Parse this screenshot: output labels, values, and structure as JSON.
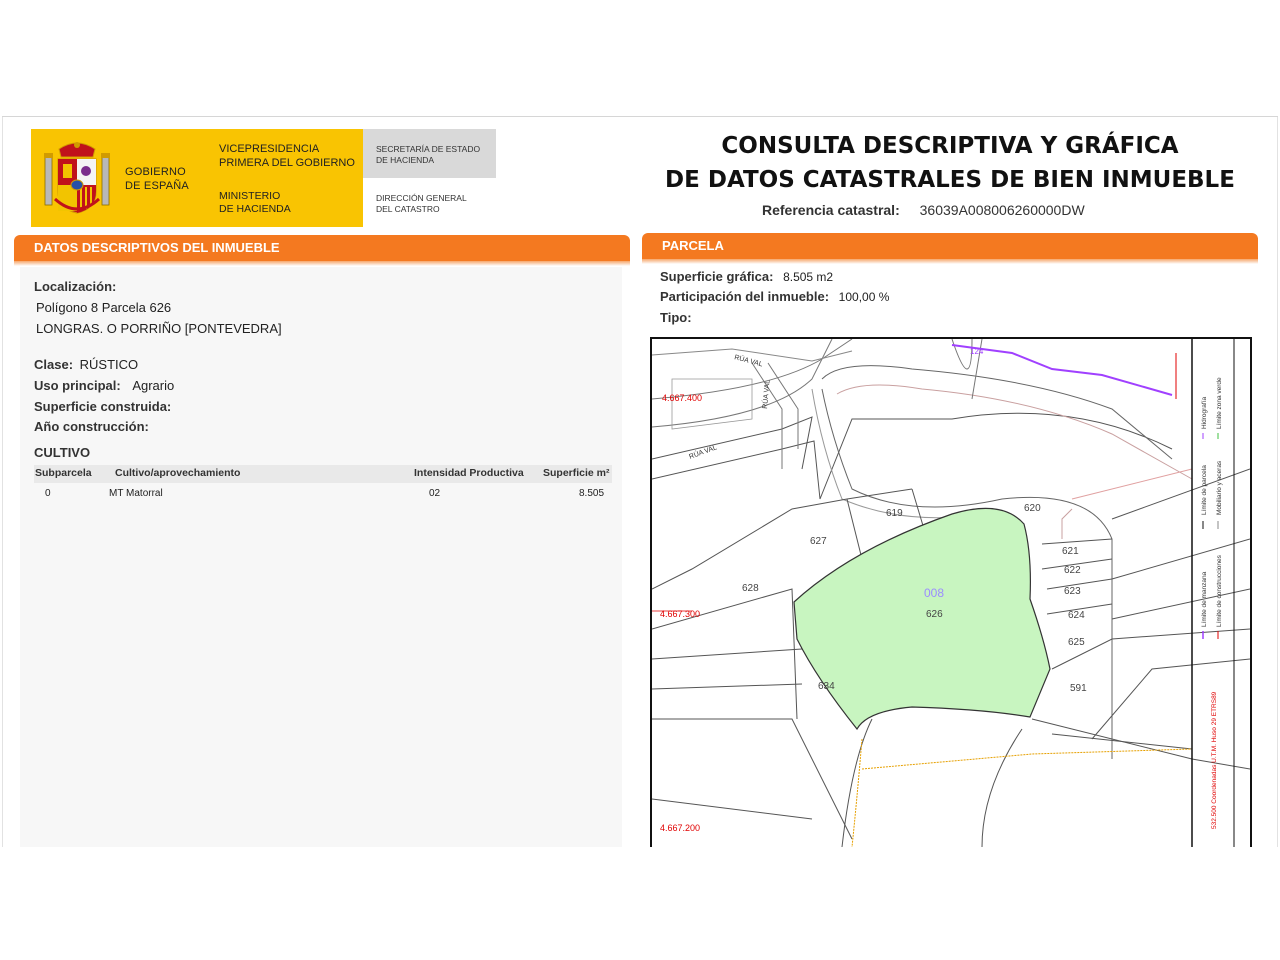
{
  "logo": {
    "gobierno": [
      "GOBIERNO",
      "DE ESPAÑA"
    ],
    "vicepresidencia": [
      "VICEPRESIDENCIA",
      "PRIMERA DEL GOBIERNO"
    ],
    "ministerio": [
      "MINISTERIO",
      "DE HACIENDA"
    ],
    "secretaria": [
      "SECRETARÍA DE ESTADO",
      "DE HACIENDA"
    ],
    "direccion": [
      "DIRECCIÓN GENERAL",
      "DEL CATASTRO"
    ],
    "colors": {
      "yellow": "#f9c402",
      "grey": "#d9d9d9"
    }
  },
  "header": {
    "title_line1": "CONSULTA DESCRIPTIVA Y GRÁFICA",
    "title_line2": "DE DATOS CATASTRALES DE BIEN INMUEBLE",
    "ref_label": "Referencia catastral:",
    "ref_value": "36039A008006260000DW"
  },
  "accent_color": "#f47920",
  "descriptivos": {
    "heading": "DATOS DESCRIPTIVOS DEL INMUEBLE",
    "localizacion_label": "Localización:",
    "localizacion_line1": "Polígono 8 Parcela 626",
    "localizacion_line2": "LONGRAS. O PORRIÑO [PONTEVEDRA]",
    "clase_label": "Clase:",
    "clase_value": "RÚSTICO",
    "uso_label": "Uso principal:",
    "uso_value": "Agrario",
    "superficie_label": "Superficie construida:",
    "anio_label": "Año construcción:",
    "cultivo": {
      "heading": "CULTIVO",
      "columns": [
        "Subparcela",
        "Cultivo/aprovechamiento",
        "Intensidad Productiva",
        "Superficie m²"
      ],
      "rows": [
        {
          "subparcela": "0",
          "cultivo": "MT Matorral",
          "intensidad": "02",
          "superficie": "8.505"
        }
      ]
    }
  },
  "parcela": {
    "heading": "PARCELA",
    "superficie_label": "Superficie gráfica:",
    "superficie_value": "8.505 m2",
    "participacion_label": "Participación del inmueble:",
    "participacion_value": "100,00 %",
    "tipo_label": "Tipo:"
  },
  "map": {
    "street_top": "RÚA VAL",
    "street_vertical": "RÚA VAL",
    "street_left": "RÚA VAL",
    "stream_label": "124",
    "coord_top": "4.667.400",
    "coord_mid": "4.667.300",
    "coord_bottom": "4.667.200",
    "polygon_label": "008",
    "parcel_labels": [
      "619",
      "620",
      "621",
      "622",
      "623",
      "624",
      "625",
      "626",
      "627",
      "628",
      "634",
      "591"
    ],
    "legend": {
      "hidrografia": "Hidrografía",
      "limite_zona_verde": "Límite zona verde",
      "limite_parcela": "Límite de parcela",
      "mobiliario": "Mobiliario y aceras",
      "limite_manzana": "Límite de manzana",
      "limite_construcciones": "Límite de construcciones",
      "coordenadas": "532.500 Coordenadas U.T.M. Huso 29 ETRS89"
    },
    "colors": {
      "parcel_fill": "#c8f5c0",
      "hydro": "#a040ff",
      "coord": "#e00000",
      "label": "#444444",
      "polygon_label": "#9b8cff"
    }
  }
}
